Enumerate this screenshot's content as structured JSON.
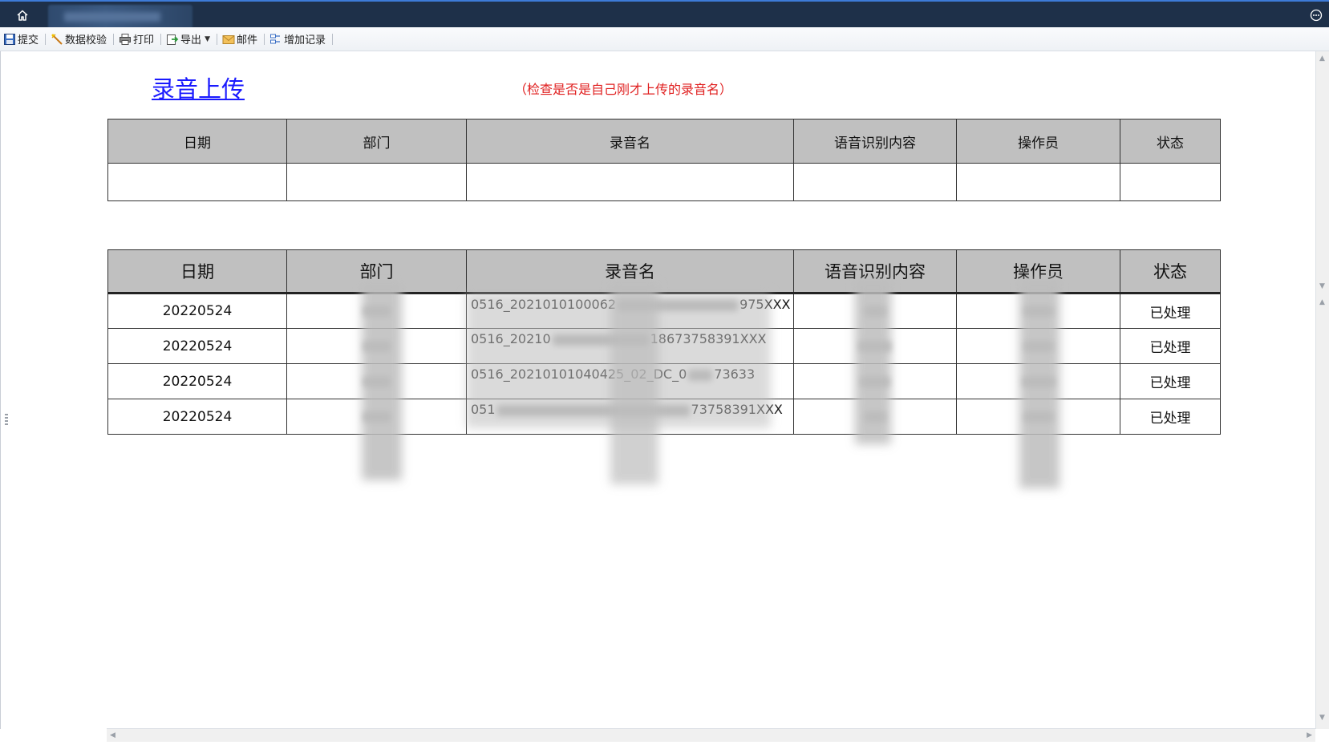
{
  "window": {
    "home_icon": "home-icon",
    "more_icon": "more-icon"
  },
  "toolbar": {
    "items": [
      {
        "label": "提交",
        "icon": "save-icon"
      },
      {
        "label": "数据校验",
        "icon": "wand-icon"
      },
      {
        "label": "打印",
        "icon": "printer-icon"
      },
      {
        "label": "导出",
        "icon": "export-icon"
      },
      {
        "label": "邮件",
        "icon": "mail-icon"
      },
      {
        "label": "增加记录",
        "icon": "add-record-icon"
      }
    ]
  },
  "page": {
    "heading": "录音上传",
    "note": "（检查是否是自己刚才上传的录音名）"
  },
  "table1": {
    "headers": [
      "日期",
      "部门",
      "录音名",
      "语音识别内容",
      "操作员",
      "状态"
    ]
  },
  "table2": {
    "headers": [
      "日期",
      "部门",
      "录音名",
      "语音识别内容",
      "操作员",
      "状态"
    ],
    "rows": [
      {
        "date": "20220524",
        "recording": "0516_2021010100062",
        "recording_tail": "975XXX",
        "status": "已处理"
      },
      {
        "date": "20220524",
        "recording": "0516_20210",
        "recording_tail": "18673758391XXX",
        "status": "已处理"
      },
      {
        "date": "20220524",
        "recording": "0516_20210101040425_02_DC_0",
        "recording_tail": "73633",
        "status": "已处理"
      },
      {
        "date": "20220524",
        "recording": "051",
        "recording_tail": "73758391XXX",
        "status": "已处理"
      }
    ]
  },
  "colors": {
    "titlebar": "#1e3049",
    "link": "#1a1aff",
    "note": "#e02020",
    "header_bg": "#c0c0c0"
  }
}
